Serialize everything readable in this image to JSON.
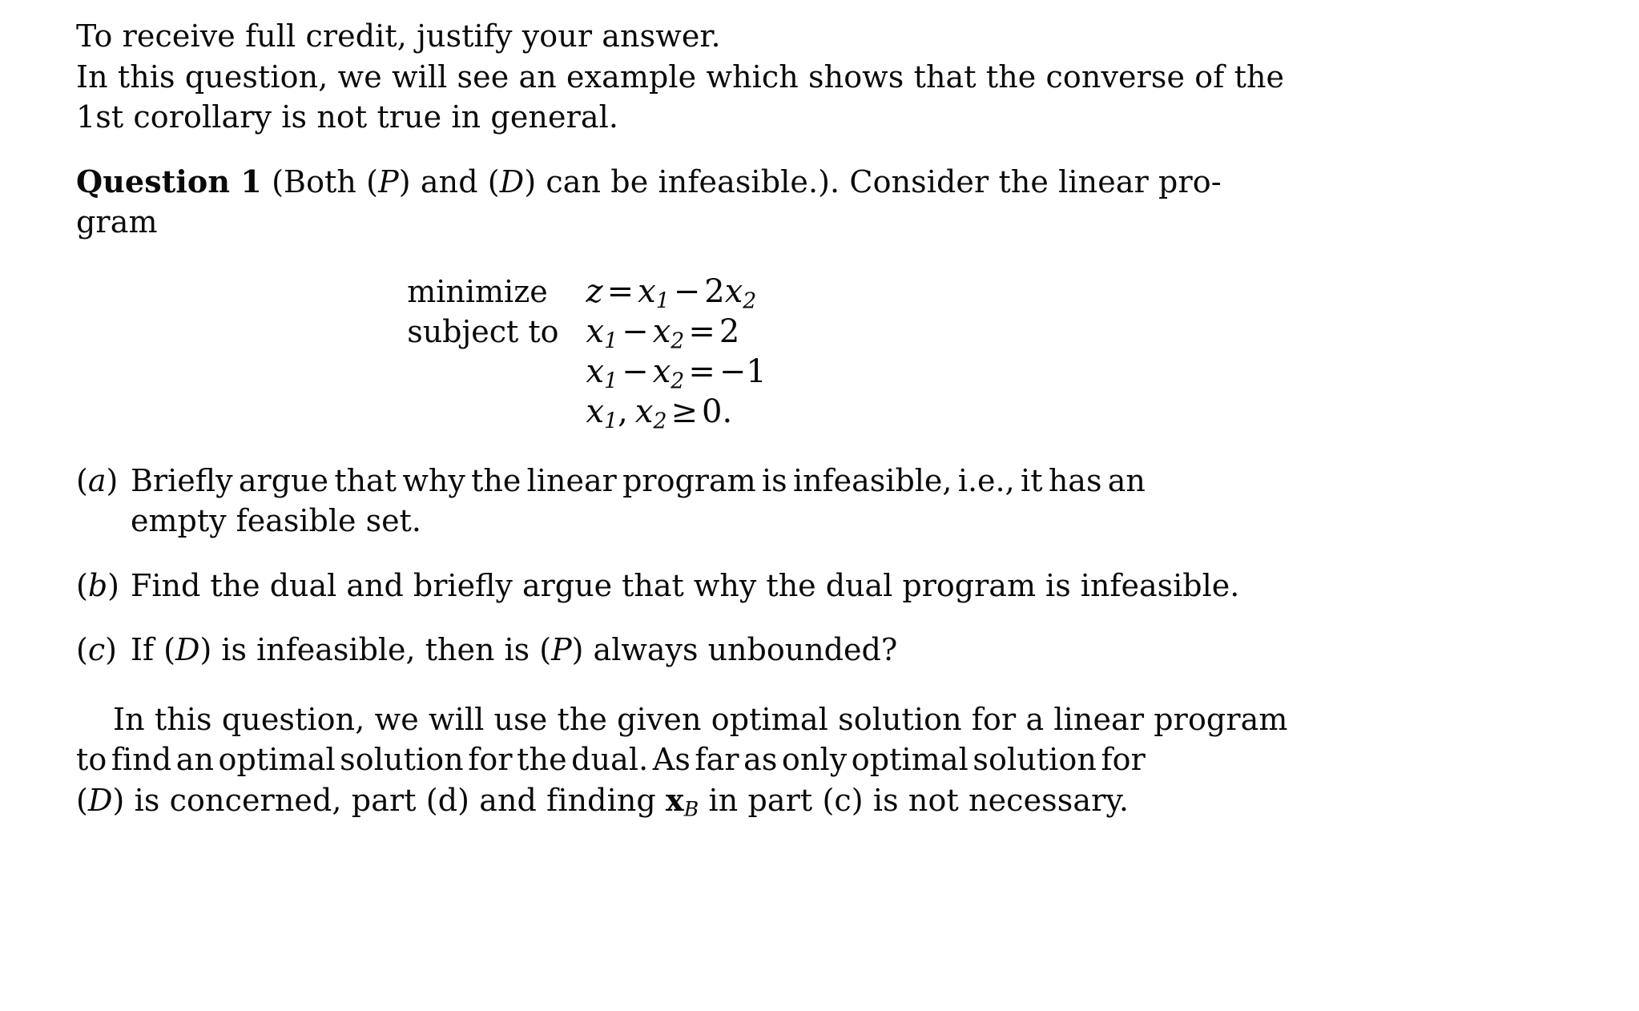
{
  "document": {
    "background_color": "#ffffff",
    "text_color": "#0a0a0a",
    "intro": {
      "line1": "To receive full credit, justify your answer.",
      "line2": "In this question, we will see an example which shows that the converse of the",
      "line3": "1st corollary is not true in general."
    },
    "question": {
      "heading": "Question 1",
      "title_part1": " (Both (",
      "title_var_p": "P",
      "title_part2": ") and (",
      "title_var_d": "D",
      "title_part3": ") can be infeasible.). Consider the linear pro-",
      "continuation": "gram"
    },
    "math": {
      "label_minimize": "minimize",
      "label_subject_to": "subject to",
      "objective": {
        "lhs": "z",
        "eq": "=",
        "term1_var": "x",
        "term1_sub": "1",
        "op": "−",
        "term2_coef": "2",
        "term2_var": "x",
        "term2_sub": "2"
      },
      "constraint1": {
        "v1": "x",
        "s1": "1",
        "op": "−",
        "v2": "x",
        "s2": "2",
        "eq": "=",
        "rhs": "2"
      },
      "constraint2": {
        "v1": "x",
        "s1": "1",
        "op": "−",
        "v2": "x",
        "s2": "2",
        "eq": "=",
        "rhs": "−1"
      },
      "nonnegativity": {
        "v1": "x",
        "s1": "1",
        "comma": ",",
        "v2": "x",
        "s2": "2",
        "rel": "≥",
        "rhs": "0."
      }
    },
    "items": [
      {
        "label_open": "(",
        "label_letter": "a",
        "label_close": ")",
        "line1_a": "Briefly",
        "line1_b": "argue",
        "line1_c": "that",
        "line1_d": "why",
        "line1_e": "the",
        "line1_f": "linear",
        "line1_g": "program",
        "line1_h": "is",
        "line1_i": "infeasible,",
        "line1_j": "i.e.,",
        "line1_k": "it",
        "line1_l": "has",
        "line1_m": "an",
        "line2": "empty feasible set."
      },
      {
        "label_open": "(",
        "label_letter": "b",
        "label_close": ")",
        "line1": "Find the dual and briefly argue that why the dual program is infeasible."
      },
      {
        "label_open": "(",
        "label_letter": "c",
        "label_close": ")",
        "line1_pre": "If (",
        "line1_var_d": "D",
        "line1_mid": ") is infeasible, then is (",
        "line1_var_p": "P",
        "line1_post": ") always unbounded?"
      }
    ],
    "closing": {
      "line1": "In this question, we will use the given optimal solution for a linear program",
      "line2_a": "to",
      "line2_b": "find",
      "line2_c": "an",
      "line2_d": "optimal",
      "line2_e": "solution",
      "line2_f": "for",
      "line2_g": "the",
      "line2_h": "dual.",
      "line2_i": "As",
      "line2_j": "far",
      "line2_k": "as",
      "line2_l": "only",
      "line2_m": "optimal",
      "line2_n": "solution",
      "line2_o": "for",
      "line3_pre": "(",
      "line3_var_d": "D",
      "line3_mid": ") is concerned, part (d) and finding ",
      "line3_bold_x": "x",
      "line3_sub_b": "B",
      "line3_post": " in part (c) is not necessary."
    }
  }
}
